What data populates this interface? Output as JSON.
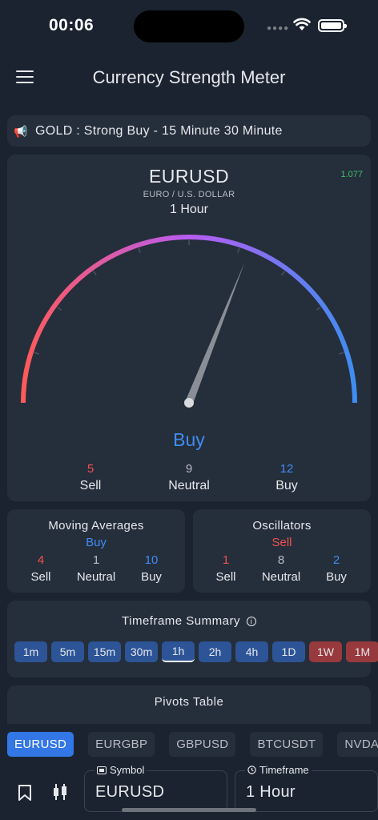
{
  "status": {
    "time": "00:06"
  },
  "header": {
    "title": "Currency Strength Meter"
  },
  "ticker": {
    "text": "GOLD : Strong Buy - 15 Minute 30 Minute"
  },
  "gauge": {
    "symbol": "EURUSD",
    "price": "1.077",
    "description": "EURO / U.S. DOLLAR",
    "timeframe": "1 Hour",
    "verdict": "Buy",
    "needle_value": 0.62,
    "gradient_colors": [
      "#ff5a5a",
      "#b85cf2",
      "#3f8df0"
    ],
    "counts": [
      {
        "value": "5",
        "label": "Sell"
      },
      {
        "value": "9",
        "label": "Neutral"
      },
      {
        "value": "12",
        "label": "Buy"
      }
    ]
  },
  "moving_averages": {
    "title": "Moving Averages",
    "verdict": "Buy",
    "counts": [
      {
        "value": "4",
        "label": "Sell"
      },
      {
        "value": "1",
        "label": "Neutral"
      },
      {
        "value": "10",
        "label": "Buy"
      }
    ]
  },
  "oscillators": {
    "title": "Oscillators",
    "verdict": "Sell",
    "counts": [
      {
        "value": "1",
        "label": "Sell"
      },
      {
        "value": "8",
        "label": "Neutral"
      },
      {
        "value": "2",
        "label": "Buy"
      }
    ]
  },
  "timeframe_summary": {
    "title": "Timeframe Summary",
    "buttons": [
      {
        "label": "1m",
        "signal": "buy"
      },
      {
        "label": "5m",
        "signal": "buy"
      },
      {
        "label": "15m",
        "signal": "buy"
      },
      {
        "label": "30m",
        "signal": "buy"
      },
      {
        "label": "1h",
        "signal": "buy"
      },
      {
        "label": "2h",
        "signal": "buy"
      },
      {
        "label": "4h",
        "signal": "buy"
      },
      {
        "label": "1D",
        "signal": "buy"
      },
      {
        "label": "1W",
        "signal": "sell"
      },
      {
        "label": "1M",
        "signal": "sell"
      }
    ],
    "active": "1h"
  },
  "pivots": {
    "title": "Pivots Table"
  },
  "symbol_tabs": {
    "items": [
      "EURUSD",
      "EURGBP",
      "GBPUSD",
      "BTCUSDT",
      "NVDA"
    ],
    "active": "EURUSD"
  },
  "selectors": {
    "symbol": {
      "label": "Symbol",
      "value": "EURUSD"
    },
    "timeframe": {
      "label": "Timeframe",
      "value": "1 Hour"
    }
  },
  "colors": {
    "sell": "#f0504f",
    "neutral": "#b8bcc4",
    "buy": "#3f8df0",
    "positive_price": "#3fc36b"
  }
}
